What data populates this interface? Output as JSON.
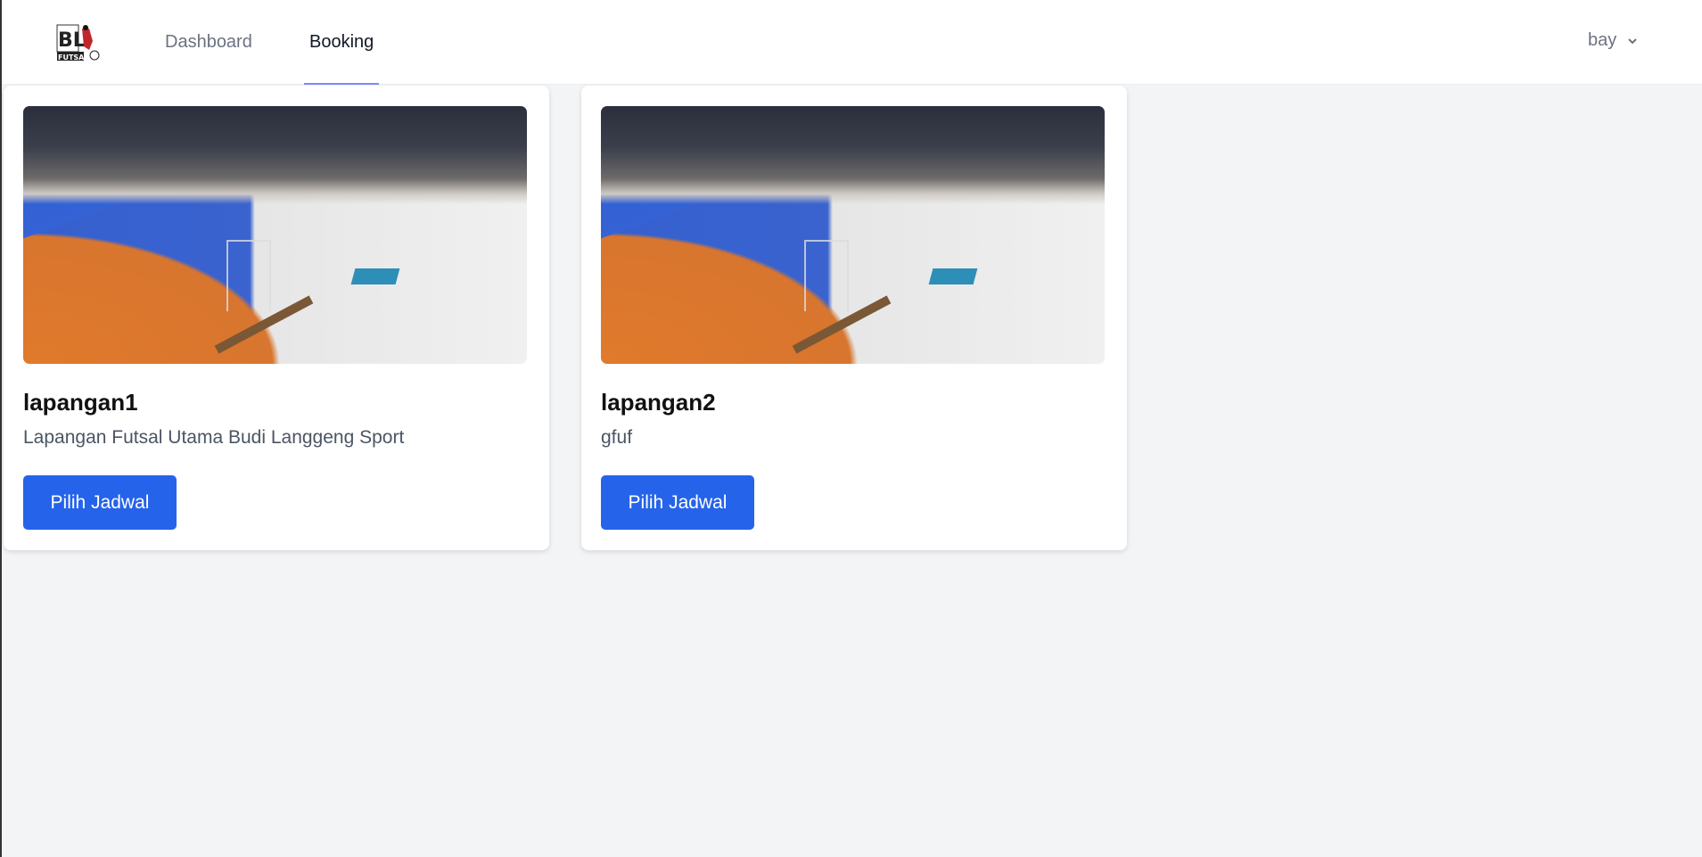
{
  "header": {
    "logo_text": "BL FUTSAL",
    "nav": [
      {
        "label": "Dashboard",
        "active": false
      },
      {
        "label": "Booking",
        "active": true
      }
    ],
    "user": {
      "name": "bay"
    }
  },
  "fields": [
    {
      "name": "lapangan1",
      "description": "Lapangan Futsal Utama Budi Langgeng Sport",
      "button_label": "Pilih Jadwal"
    },
    {
      "name": "lapangan2",
      "description": "gfuf",
      "button_label": "Pilih Jadwal"
    }
  ],
  "colors": {
    "primary": "#2563eb",
    "underline": "#818cf8",
    "background": "#f3f4f6"
  }
}
